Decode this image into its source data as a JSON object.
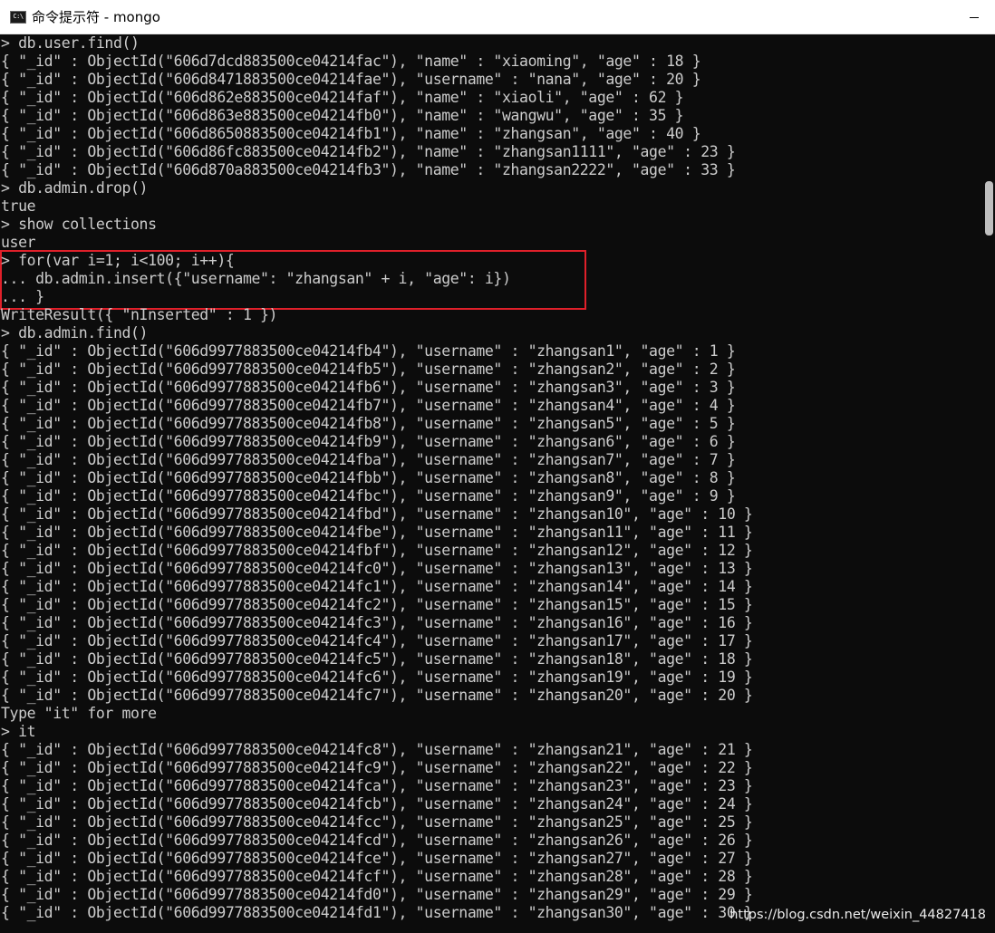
{
  "window": {
    "title": "命令提示符 - mongo",
    "icon_label": "C:\\"
  },
  "console_lines": [
    "> db.user.find()",
    "{ \"_id\" : ObjectId(\"606d7dcd883500ce04214fac\"), \"name\" : \"xiaoming\", \"age\" : 18 }",
    "{ \"_id\" : ObjectId(\"606d8471883500ce04214fae\"), \"username\" : \"nana\", \"age\" : 20 }",
    "{ \"_id\" : ObjectId(\"606d862e883500ce04214faf\"), \"name\" : \"xiaoli\", \"age\" : 62 }",
    "{ \"_id\" : ObjectId(\"606d863e883500ce04214fb0\"), \"name\" : \"wangwu\", \"age\" : 35 }",
    "{ \"_id\" : ObjectId(\"606d8650883500ce04214fb1\"), \"name\" : \"zhangsan\", \"age\" : 40 }",
    "{ \"_id\" : ObjectId(\"606d86fc883500ce04214fb2\"), \"name\" : \"zhangsan1111\", \"age\" : 23 }",
    "{ \"_id\" : ObjectId(\"606d870a883500ce04214fb3\"), \"name\" : \"zhangsan2222\", \"age\" : 33 }",
    "> db.admin.drop()",
    "true",
    "> show collections",
    "user",
    "> for(var i=1; i<100; i++){",
    "... db.admin.insert({\"username\": \"zhangsan\" + i, \"age\": i})",
    "... }",
    "WriteResult({ \"nInserted\" : 1 })",
    "> db.admin.find()",
    "{ \"_id\" : ObjectId(\"606d9977883500ce04214fb4\"), \"username\" : \"zhangsan1\", \"age\" : 1 }",
    "{ \"_id\" : ObjectId(\"606d9977883500ce04214fb5\"), \"username\" : \"zhangsan2\", \"age\" : 2 }",
    "{ \"_id\" : ObjectId(\"606d9977883500ce04214fb6\"), \"username\" : \"zhangsan3\", \"age\" : 3 }",
    "{ \"_id\" : ObjectId(\"606d9977883500ce04214fb7\"), \"username\" : \"zhangsan4\", \"age\" : 4 }",
    "{ \"_id\" : ObjectId(\"606d9977883500ce04214fb8\"), \"username\" : \"zhangsan5\", \"age\" : 5 }",
    "{ \"_id\" : ObjectId(\"606d9977883500ce04214fb9\"), \"username\" : \"zhangsan6\", \"age\" : 6 }",
    "{ \"_id\" : ObjectId(\"606d9977883500ce04214fba\"), \"username\" : \"zhangsan7\", \"age\" : 7 }",
    "{ \"_id\" : ObjectId(\"606d9977883500ce04214fbb\"), \"username\" : \"zhangsan8\", \"age\" : 8 }",
    "{ \"_id\" : ObjectId(\"606d9977883500ce04214fbc\"), \"username\" : \"zhangsan9\", \"age\" : 9 }",
    "{ \"_id\" : ObjectId(\"606d9977883500ce04214fbd\"), \"username\" : \"zhangsan10\", \"age\" : 10 }",
    "{ \"_id\" : ObjectId(\"606d9977883500ce04214fbe\"), \"username\" : \"zhangsan11\", \"age\" : 11 }",
    "{ \"_id\" : ObjectId(\"606d9977883500ce04214fbf\"), \"username\" : \"zhangsan12\", \"age\" : 12 }",
    "{ \"_id\" : ObjectId(\"606d9977883500ce04214fc0\"), \"username\" : \"zhangsan13\", \"age\" : 13 }",
    "{ \"_id\" : ObjectId(\"606d9977883500ce04214fc1\"), \"username\" : \"zhangsan14\", \"age\" : 14 }",
    "{ \"_id\" : ObjectId(\"606d9977883500ce04214fc2\"), \"username\" : \"zhangsan15\", \"age\" : 15 }",
    "{ \"_id\" : ObjectId(\"606d9977883500ce04214fc3\"), \"username\" : \"zhangsan16\", \"age\" : 16 }",
    "{ \"_id\" : ObjectId(\"606d9977883500ce04214fc4\"), \"username\" : \"zhangsan17\", \"age\" : 17 }",
    "{ \"_id\" : ObjectId(\"606d9977883500ce04214fc5\"), \"username\" : \"zhangsan18\", \"age\" : 18 }",
    "{ \"_id\" : ObjectId(\"606d9977883500ce04214fc6\"), \"username\" : \"zhangsan19\", \"age\" : 19 }",
    "{ \"_id\" : ObjectId(\"606d9977883500ce04214fc7\"), \"username\" : \"zhangsan20\", \"age\" : 20 }",
    "Type \"it\" for more",
    "> it",
    "{ \"_id\" : ObjectId(\"606d9977883500ce04214fc8\"), \"username\" : \"zhangsan21\", \"age\" : 21 }",
    "{ \"_id\" : ObjectId(\"606d9977883500ce04214fc9\"), \"username\" : \"zhangsan22\", \"age\" : 22 }",
    "{ \"_id\" : ObjectId(\"606d9977883500ce04214fca\"), \"username\" : \"zhangsan23\", \"age\" : 23 }",
    "{ \"_id\" : ObjectId(\"606d9977883500ce04214fcb\"), \"username\" : \"zhangsan24\", \"age\" : 24 }",
    "{ \"_id\" : ObjectId(\"606d9977883500ce04214fcc\"), \"username\" : \"zhangsan25\", \"age\" : 25 }",
    "{ \"_id\" : ObjectId(\"606d9977883500ce04214fcd\"), \"username\" : \"zhangsan26\", \"age\" : 26 }",
    "{ \"_id\" : ObjectId(\"606d9977883500ce04214fce\"), \"username\" : \"zhangsan27\", \"age\" : 27 }",
    "{ \"_id\" : ObjectId(\"606d9977883500ce04214fcf\"), \"username\" : \"zhangsan28\", \"age\" : 28 }",
    "{ \"_id\" : ObjectId(\"606d9977883500ce04214fd0\"), \"username\" : \"zhangsan29\", \"age\" : 29 }",
    "{ \"_id\" : ObjectId(\"606d9977883500ce04214fd1\"), \"username\" : \"zhangsan30\", \"age\" : 30 }"
  ],
  "watermark": "https://blog.csdn.net/weixin_44827418",
  "colors": {
    "console_bg": "#0c0c0c",
    "console_text": "#cccccc",
    "highlight": "#e0202a",
    "titlebar_bg": "#ffffff"
  }
}
